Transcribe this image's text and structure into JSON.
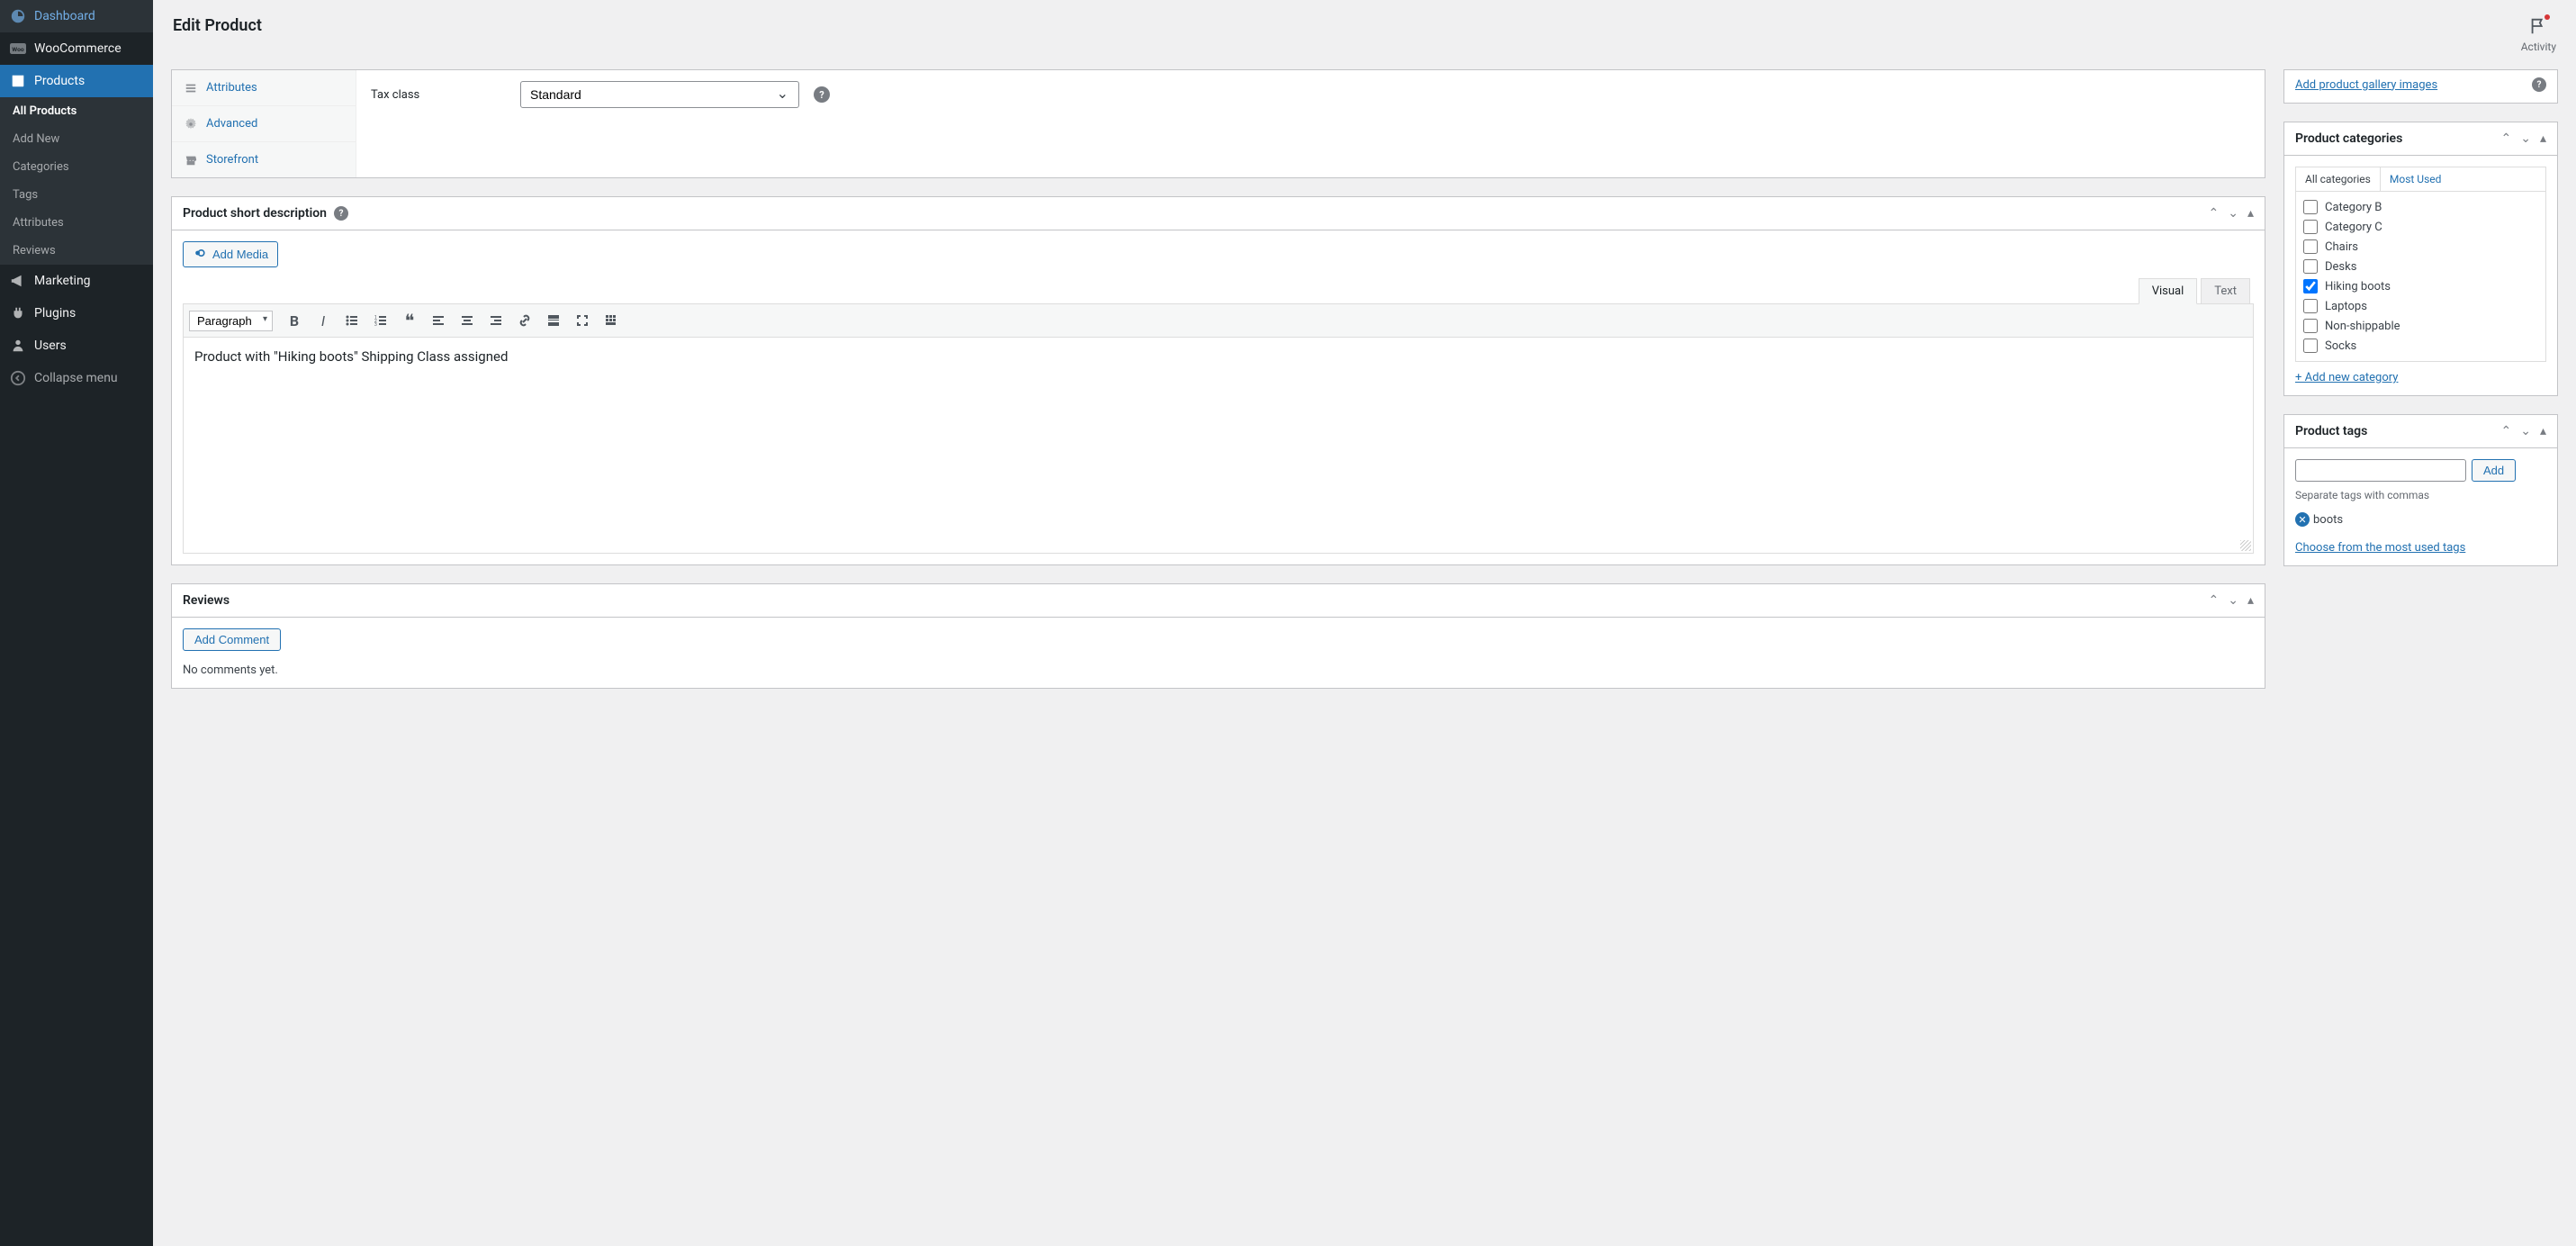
{
  "header": {
    "title": "Edit Product",
    "activity_label": "Activity"
  },
  "sidebar": {
    "items": [
      {
        "id": "dashboard",
        "label": "Dashboard",
        "icon": "dashboard"
      },
      {
        "id": "woocommerce",
        "label": "WooCommerce",
        "icon": "woo"
      },
      {
        "id": "products",
        "label": "Products",
        "icon": "products",
        "active": true
      },
      {
        "id": "marketing",
        "label": "Marketing",
        "icon": "marketing"
      },
      {
        "id": "plugins",
        "label": "Plugins",
        "icon": "plugins"
      },
      {
        "id": "users",
        "label": "Users",
        "icon": "users"
      },
      {
        "id": "collapse",
        "label": "Collapse menu",
        "icon": "collapse"
      }
    ],
    "products_sub": [
      {
        "label": "All Products",
        "current": true
      },
      {
        "label": "Add New"
      },
      {
        "label": "Categories"
      },
      {
        "label": "Tags"
      },
      {
        "label": "Attributes"
      },
      {
        "label": "Reviews"
      }
    ]
  },
  "product_data": {
    "tabs": [
      {
        "label": "Attributes",
        "icon": "list"
      },
      {
        "label": "Advanced",
        "icon": "gear"
      },
      {
        "label": "Storefront",
        "icon": "store"
      }
    ],
    "tax_class_label": "Tax class",
    "tax_class_value": "Standard"
  },
  "short_desc": {
    "panel_title": "Product short description",
    "add_media": "Add Media",
    "visual_tab": "Visual",
    "text_tab": "Text",
    "format_select": "Paragraph",
    "content": "Product with \"Hiking boots\" Shipping Class assigned"
  },
  "reviews": {
    "panel_title": "Reviews",
    "add_comment": "Add Comment",
    "empty": "No comments yet."
  },
  "gallery": {
    "add_link": "Add product gallery images"
  },
  "categories": {
    "panel_title": "Product categories",
    "tab_all": "All categories",
    "tab_most": "Most Used",
    "items": [
      {
        "label": "Category B",
        "checked": false
      },
      {
        "label": "Category C",
        "checked": false
      },
      {
        "label": "Chairs",
        "checked": false
      },
      {
        "label": "Desks",
        "checked": false
      },
      {
        "label": "Hiking boots",
        "checked": true
      },
      {
        "label": "Laptops",
        "checked": false
      },
      {
        "label": "Non-shippable",
        "checked": false
      },
      {
        "label": "Socks",
        "checked": false
      }
    ],
    "add_new": "+ Add new category"
  },
  "tags": {
    "panel_title": "Product tags",
    "add_button": "Add",
    "hint": "Separate tags with commas",
    "items": [
      {
        "label": "boots"
      }
    ],
    "choose_link": "Choose from the most used tags"
  }
}
